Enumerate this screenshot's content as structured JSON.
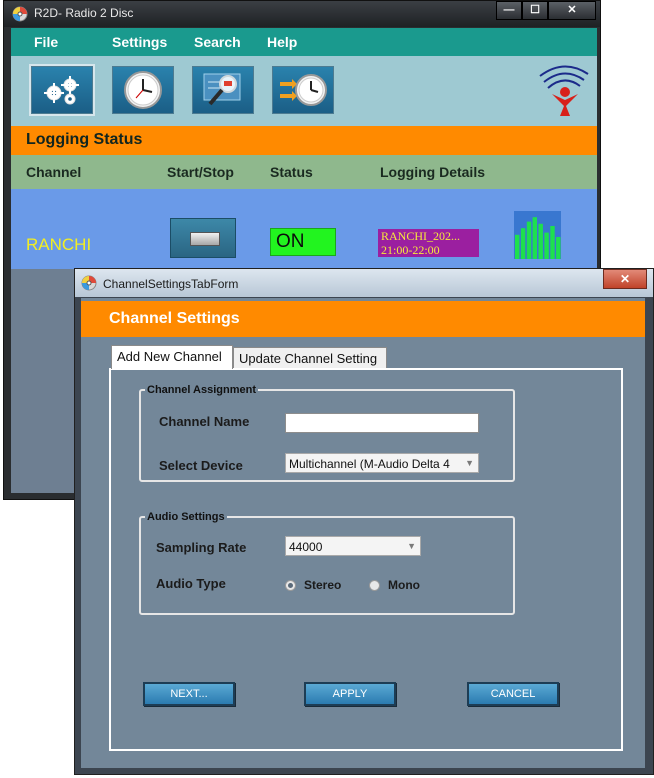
{
  "main_window": {
    "title": "R2D- Radio 2 Disc",
    "controls": {
      "minimize": "—",
      "maximize": "☐",
      "close": "✕"
    },
    "menu": [
      "File",
      "Settings",
      "Search",
      "Help"
    ],
    "toolbar": {
      "buttons": [
        {
          "name": "settings-gears",
          "icon": "gears-icon"
        },
        {
          "name": "clock",
          "icon": "clock-icon"
        },
        {
          "name": "search",
          "icon": "magnifier-icon"
        },
        {
          "name": "schedule",
          "icon": "arrows-clock-icon"
        }
      ]
    },
    "logging_status_label": "Logging Status",
    "columns": [
      "Channel",
      "Start/Stop",
      "Status",
      "Logging Details"
    ],
    "channel_row": {
      "channel": "RANCHI",
      "status": "ON",
      "details_line1": "RANCHI_202...",
      "details_line2": "21:00-22:00",
      "level_bars": [
        0.55,
        0.7,
        0.85,
        0.95,
        0.8,
        0.6,
        0.75,
        0.5
      ]
    },
    "colors": {
      "menubar": "#1a9a8e",
      "toolbar": "#9ec9d2",
      "section_header": "#ff8a00",
      "column_header": "#8fb88d",
      "channel_row": "#6a9ae8",
      "status_on": "#22f41f",
      "details_bg": "#9b1fa0",
      "channel_text": "#f2ee24"
    }
  },
  "dialog": {
    "title": "ChannelSettingsTabForm",
    "close": "✕",
    "banner": "Channel Settings",
    "tabs": [
      "Add New Channel",
      "Update Channel Setting"
    ],
    "channel_assignment": {
      "legend": "Channel Assignment",
      "channel_name_label": "Channel Name",
      "channel_name_value": "",
      "select_device_label": "Select Device",
      "select_device_value": "Multichannel (M-Audio Delta 4"
    },
    "audio_settings": {
      "legend": "Audio Settings",
      "sampling_rate_label": "Sampling Rate",
      "sampling_rate_value": "44000",
      "audio_type_label": "Audio Type",
      "options": [
        "Stereo",
        "Mono"
      ],
      "selected": "Stereo"
    },
    "buttons": {
      "next": "NEXT...",
      "apply": "APPLY",
      "cancel": "CANCEL"
    }
  }
}
